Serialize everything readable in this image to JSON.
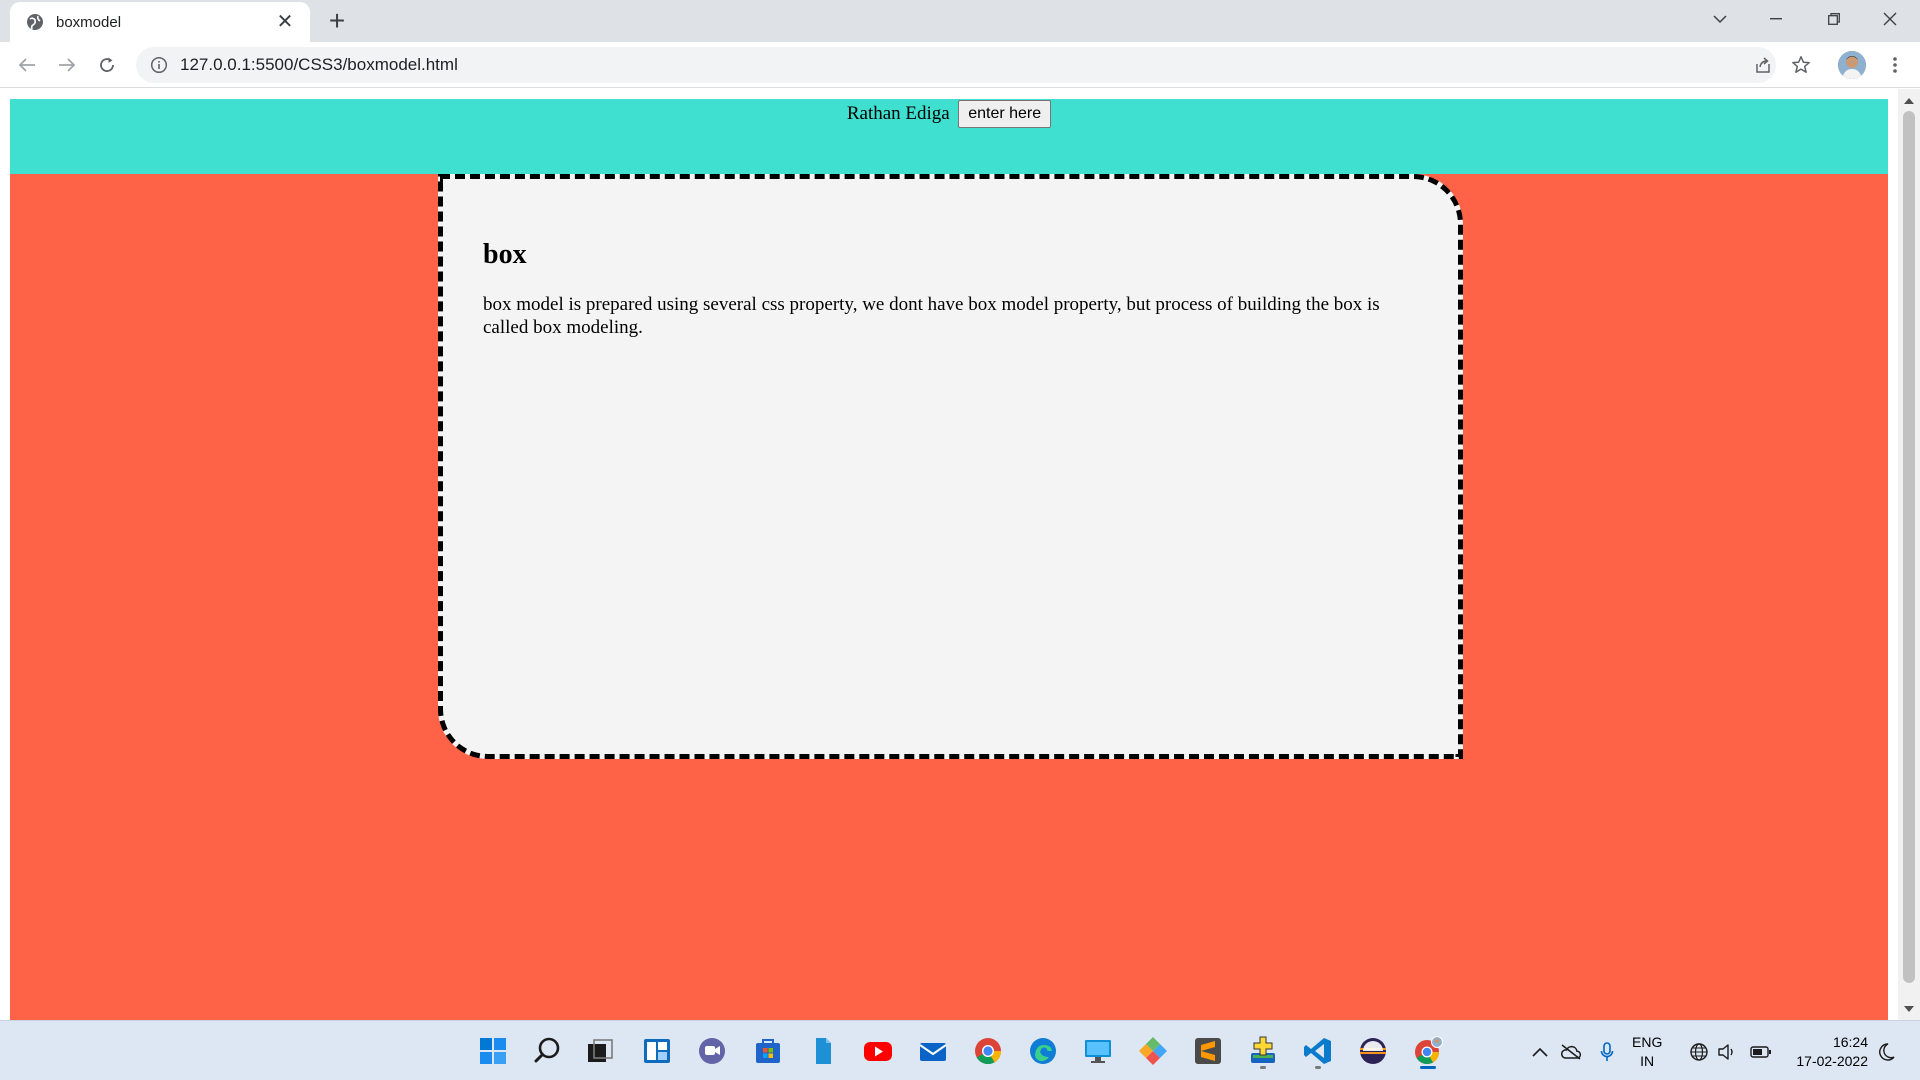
{
  "browser": {
    "tab_title": "boxmodel",
    "tab_close": "✕",
    "new_tab": "+",
    "url": "127.0.0.1:5500/CSS3/boxmodel.html"
  },
  "page": {
    "header": {
      "name_text": "Rathan Ediga",
      "button_label": "enter here"
    },
    "box": {
      "heading": "box",
      "paragraph": "box model is prepared using several css property, we dont have box model property, but process of building the box is called box modeling."
    },
    "colors": {
      "header_band": "#40e0d0",
      "body_background": "#ff6347",
      "box_background": "#f4f4f4"
    }
  },
  "taskbar": {
    "apps": [
      "windows-start-icon",
      "search-icon",
      "task-view-icon",
      "widgets-icon",
      "teams-chat-icon",
      "microsoft-store-icon",
      "file-icon",
      "youtube-icon",
      "mail-icon",
      "chrome-icon",
      "edge-icon",
      "remote-desktop-icon",
      "app-icon",
      "sublime-text-icon",
      "installer-icon",
      "vscode-icon",
      "eclipse-icon",
      "chrome-profile-icon"
    ],
    "language_line1": "ENG",
    "language_line2": "IN",
    "time": "16:24",
    "date": "17-02-2022"
  }
}
